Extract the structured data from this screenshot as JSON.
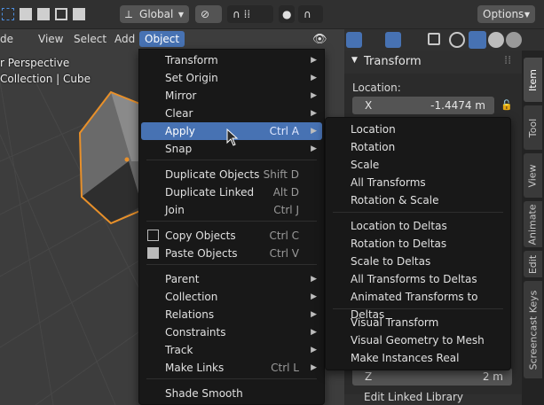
{
  "header": {
    "orientation": "Global",
    "options": "Options"
  },
  "menubar": {
    "items": [
      "de",
      "View",
      "Select",
      "Add",
      "Object"
    ]
  },
  "viewport": {
    "perspective": "r Perspective",
    "collection": "Collection | Cube"
  },
  "object_menu": {
    "items": [
      {
        "label": "Transform",
        "shortcut": "",
        "arrow": true
      },
      {
        "label": "Set Origin",
        "shortcut": "",
        "arrow": true
      },
      {
        "label": "Mirror",
        "shortcut": "",
        "arrow": true
      },
      {
        "label": "Clear",
        "shortcut": "",
        "arrow": true
      },
      {
        "label": "Apply",
        "shortcut": "Ctrl A",
        "arrow": true
      },
      {
        "label": "Snap",
        "shortcut": "",
        "arrow": true
      },
      {
        "label": "Duplicate Objects",
        "shortcut": "Shift D",
        "arrow": false
      },
      {
        "label": "Duplicate Linked",
        "shortcut": "Alt D",
        "arrow": false
      },
      {
        "label": "Join",
        "shortcut": "Ctrl J",
        "arrow": false
      },
      {
        "label": "Copy Objects",
        "shortcut": "Ctrl C",
        "arrow": false
      },
      {
        "label": "Paste Objects",
        "shortcut": "Ctrl V",
        "arrow": false
      },
      {
        "label": "Parent",
        "shortcut": "",
        "arrow": true
      },
      {
        "label": "Collection",
        "shortcut": "",
        "arrow": true
      },
      {
        "label": "Relations",
        "shortcut": "",
        "arrow": true
      },
      {
        "label": "Constraints",
        "shortcut": "",
        "arrow": true
      },
      {
        "label": "Track",
        "shortcut": "",
        "arrow": true
      },
      {
        "label": "Make Links",
        "shortcut": "Ctrl L",
        "arrow": true
      },
      {
        "label": "Shade Smooth",
        "shortcut": "",
        "arrow": false
      }
    ]
  },
  "apply_menu": {
    "items": [
      "Location",
      "Rotation",
      "Scale",
      "All Transforms",
      "Rotation & Scale",
      "Location to Deltas",
      "Rotation to Deltas",
      "Scale to Deltas",
      "All Transforms to Deltas",
      "Animated Transforms to Deltas",
      "Visual Transform",
      "Visual Geometry to Mesh",
      "Make Instances Real"
    ]
  },
  "npanel": {
    "title": "Transform",
    "location_label": "Location:",
    "x_label": "X",
    "x_value": "-1.4474 m",
    "z_label": "Z",
    "z_value": "2 m",
    "bottom_label": "Edit Linked Library"
  },
  "tabs": [
    "Item",
    "Tool",
    "View",
    "Animate",
    "Edit",
    "Screencast Keys"
  ],
  "colors": {
    "highlight": "#4772b3",
    "selection_outline": "#e8902a"
  }
}
